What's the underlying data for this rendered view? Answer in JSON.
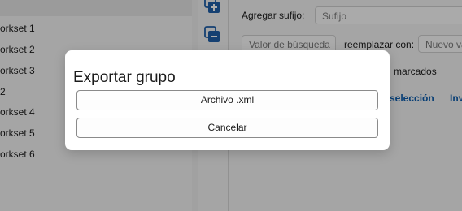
{
  "worksets": [
    {
      "label": "orkset 1"
    },
    {
      "label": "orkset 2"
    },
    {
      "label": "orkset 3"
    },
    {
      "label": "2"
    },
    {
      "label": "orkset 4"
    },
    {
      "label": "orkset 5"
    },
    {
      "label": "orkset 6"
    }
  ],
  "toolbar": {
    "add_icon": "add-set-icon",
    "remove_icon": "remove-set-icon",
    "accent_color": "#1f5fa8"
  },
  "options": {
    "suffix_label": "Agregar sufijo:",
    "suffix_placeholder": "Sufijo",
    "search_placeholder": "Valor de búsqueda",
    "replace_label": "reemplazar con:",
    "replace_placeholder": "Nuevo valor",
    "marked_label": "marcados",
    "selection_link": "selección",
    "invert_link": "Inv"
  },
  "dialog": {
    "title": "Exportar grupo",
    "xml_button": "Archivo .xml",
    "cancel_button": "Cancelar"
  }
}
